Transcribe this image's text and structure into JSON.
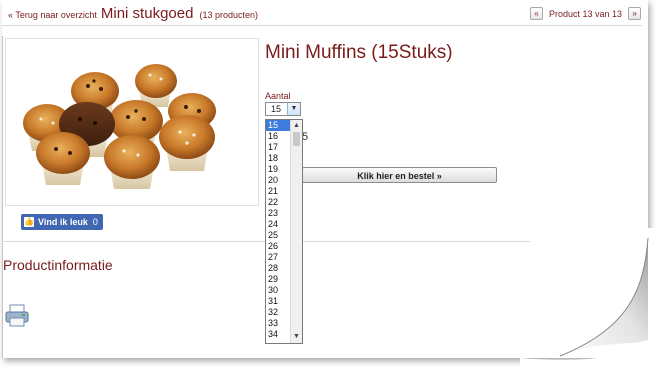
{
  "header": {
    "back_link": "« Terug naar overzicht",
    "category": "Mini stukgoed",
    "count": "(13 producten)",
    "pager_prev": "«",
    "pager_text": "Product 13 van 13",
    "pager_next": "»"
  },
  "product": {
    "title": "Mini Muffins (15Stuks)",
    "image_icon": "muffins-image",
    "qty_label": "Aantal",
    "qty_value": "15",
    "price_peek": "5",
    "order_button": "Klik hier en bestel »"
  },
  "like": {
    "label": "Vind ik leuk",
    "count": "0"
  },
  "qty_options": [
    "15",
    "16",
    "17",
    "18",
    "19",
    "20",
    "21",
    "22",
    "23",
    "24",
    "25",
    "26",
    "27",
    "28",
    "29",
    "30",
    "31",
    "32",
    "33",
    "34"
  ],
  "info": {
    "title": "Productinformatie",
    "print_icon": "printer-icon"
  },
  "colors": {
    "accent": "#7a1b1b",
    "selected": "#3d7bdc",
    "facebook": "#4267b2"
  }
}
